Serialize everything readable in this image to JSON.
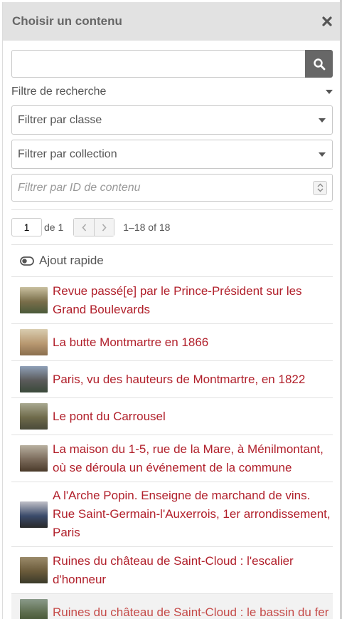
{
  "dialog": {
    "title": "Choisir un contenu",
    "close_icon": "close-icon"
  },
  "search": {
    "value": "",
    "placeholder": "",
    "icon": "search-icon"
  },
  "filters": {
    "heading": "Filtre de recherche",
    "class_select": "Filtrer par classe",
    "collection_select": "Filtrer par collection",
    "id_placeholder": "Filtrer par ID de contenu"
  },
  "pagination": {
    "page": "1",
    "of_total": "de 1",
    "range": "1–18 of 18"
  },
  "quick_add": {
    "label": "Ajout rapide",
    "icon": "toggle-icon"
  },
  "items": [
    {
      "title": "Revue passé[e] par le Prince-Président sur les Grand Boulevards",
      "thumb_colors": [
        "#c9c0a0",
        "#7a6e4a",
        "#4a5a3a"
      ]
    },
    {
      "title": "La butte Montmartre en 1866",
      "thumb_colors": [
        "#d9cdb0",
        "#b89870",
        "#8a6e4e"
      ]
    },
    {
      "title": "Paris, vu des hauteurs de Montmartre, en 1822",
      "thumb_colors": [
        "#8fa0b8",
        "#5a5a5a",
        "#3a4a3a"
      ]
    },
    {
      "title": "Le pont du Carrousel",
      "thumb_colors": [
        "#a8a890",
        "#6e6a4a",
        "#4a4a3a"
      ]
    },
    {
      "title": "La maison du 1-5, rue de la Mare, à Ménilmontant, où se déroula un événement de la commune",
      "thumb_colors": [
        "#b8b0a0",
        "#7a6a5a",
        "#4a3a2a"
      ]
    },
    {
      "title": "A l'Arche Popin. Enseigne de marchand de vins. Rue Saint-Germain-l'Auxerrois, 1er arrondissement, Paris",
      "thumb_colors": [
        "#c0c0c8",
        "#3a4a6a",
        "#2a2a2a"
      ]
    },
    {
      "title": "Ruines du château de Saint-Cloud : l'escalier d'honneur",
      "thumb_colors": [
        "#9a8a6a",
        "#6a5a3a",
        "#3a3a2a"
      ]
    },
    {
      "title": "Ruines du château de Saint-Cloud : le bassin du fer",
      "thumb_colors": [
        "#8a9a8a",
        "#5a6a4a",
        "#3a4a2a"
      ]
    }
  ]
}
